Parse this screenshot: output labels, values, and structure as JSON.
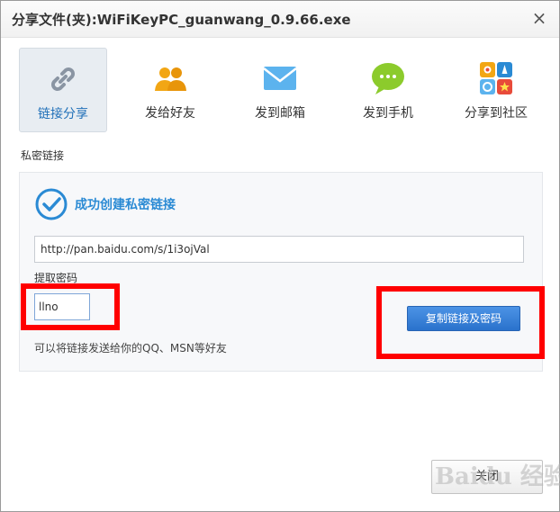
{
  "window": {
    "title": "分享文件(夹):WiFiKeyPC_guanwang_0.9.66.exe",
    "close_glyph": "×"
  },
  "tabs": [
    {
      "label": "链接分享",
      "icon": "link-icon",
      "active": true
    },
    {
      "label": "发给好友",
      "icon": "friends-icon",
      "active": false
    },
    {
      "label": "发到邮箱",
      "icon": "mail-icon",
      "active": false
    },
    {
      "label": "发到手机",
      "icon": "sms-icon",
      "active": false
    },
    {
      "label": "分享到社区",
      "icon": "community-icon",
      "active": false
    }
  ],
  "private_link": {
    "section_label": "私密链接",
    "success_message": "成功创建私密链接",
    "url_value": "http://pan.baidu.com/s/1i3ojVal",
    "password_label": "提取密码",
    "password_value": "llno",
    "copy_button_label": "复制链接及密码",
    "hint": "可以将链接发送给你的QQ、MSN等好友"
  },
  "footer": {
    "close_button_label": "关闭"
  },
  "watermark": {
    "text": "Baidu 经验"
  },
  "colors": {
    "accent": "#2a8ad4",
    "highlight": "#ff0000",
    "button_blue": "#2a72cc"
  }
}
